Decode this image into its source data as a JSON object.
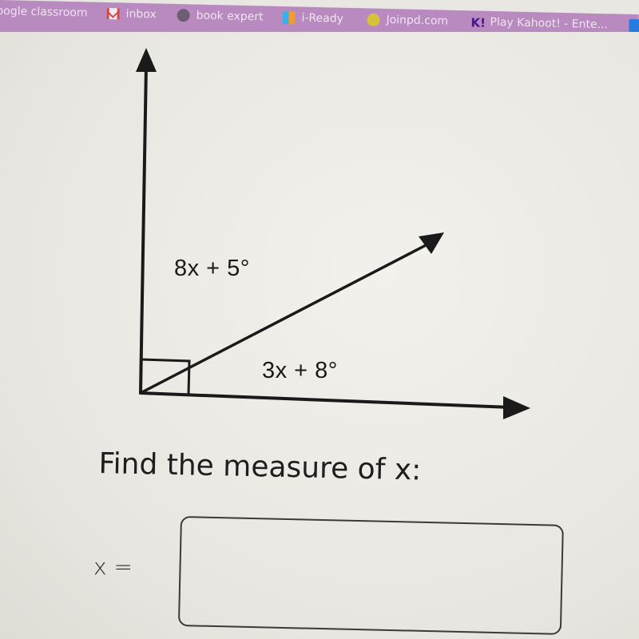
{
  "bookmarks": [
    {
      "label": "oogle classroom",
      "icon": "none"
    },
    {
      "label": "inbox",
      "icon": "gmail-icon"
    },
    {
      "label": "book expert",
      "icon": "book-expert-icon"
    },
    {
      "label": "i-Ready",
      "icon": "iready-icon"
    },
    {
      "label": "Joinpd.com",
      "icon": "pear-deck-icon"
    },
    {
      "label": "Play Kahoot! - Ente...",
      "icon": "kahoot-icon",
      "icon_text": "K!"
    }
  ],
  "diagram": {
    "upper_angle_label": "8x + 5°",
    "lower_angle_label": "3x + 8°",
    "right_angle_marker": true
  },
  "question": {
    "prompt": "Find the measure of x:",
    "answer_label": "x =",
    "answer_value": ""
  },
  "colors": {
    "bookmarks_bar": "#b98abf",
    "page_background": "#ecebe6",
    "ink": "#1a1a1a"
  }
}
